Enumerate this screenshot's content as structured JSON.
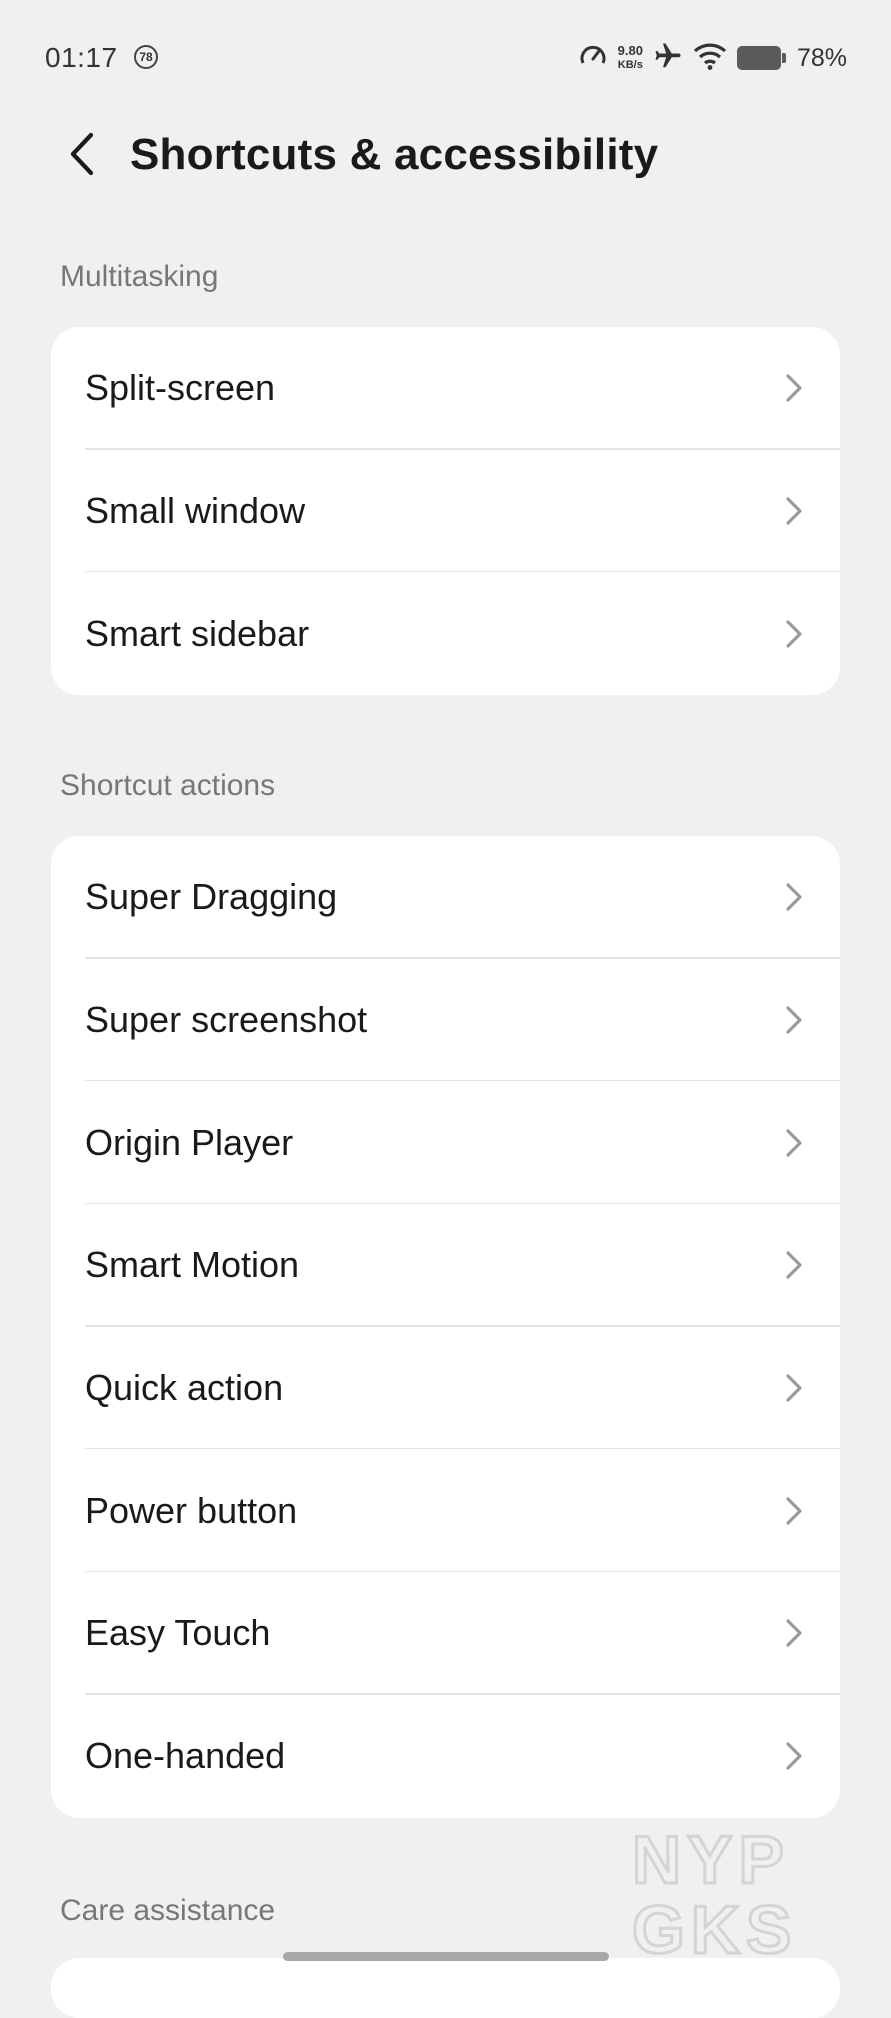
{
  "status": {
    "time": "01:17",
    "notification_count": "78",
    "speed_value": "9.80",
    "speed_unit": "KB/s",
    "battery_percent": "78%"
  },
  "header": {
    "title": "Shortcuts & accessibility"
  },
  "sections": [
    {
      "label": "Multitasking",
      "items": [
        "Split-screen",
        "Small window",
        "Smart sidebar"
      ]
    },
    {
      "label": "Shortcut actions",
      "items": [
        "Super Dragging",
        "Super screenshot",
        "Origin Player",
        "Smart Motion",
        "Quick action",
        "Power button",
        "Easy Touch",
        "One-handed"
      ]
    },
    {
      "label": "Care assistance",
      "items": []
    }
  ],
  "watermark": {
    "line1": "NYP",
    "line2": "GKS"
  },
  "colors": {
    "background": "#f0f0f2",
    "card": "#ffffff",
    "section_label": "#777777",
    "chevron": "#9a9a9a"
  }
}
